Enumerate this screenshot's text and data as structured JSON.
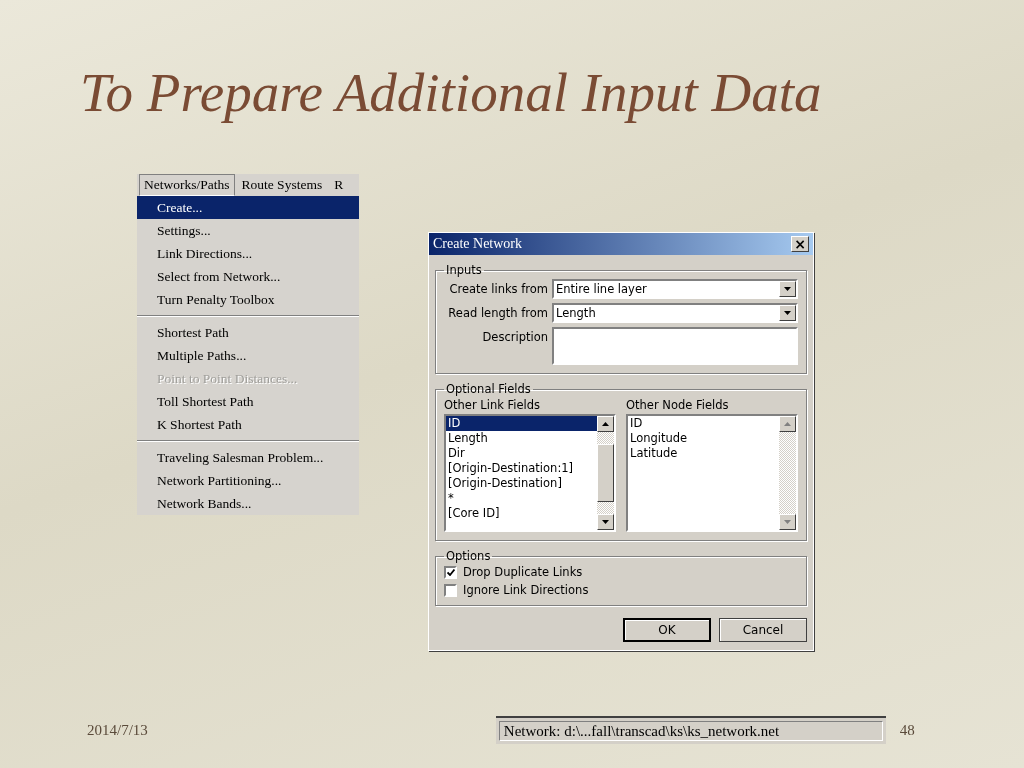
{
  "slide": {
    "title": "To Prepare Additional Input Data",
    "date": "2014/7/13",
    "page_number": "48"
  },
  "menu": {
    "menubar": [
      {
        "label": "Networks/Paths",
        "selected": true
      },
      {
        "label": "Route Systems",
        "selected": false
      },
      {
        "label": "R",
        "selected": false
      }
    ],
    "groups": [
      [
        {
          "label": "Create...",
          "selected": true,
          "disabled": false
        },
        {
          "label": "Settings...",
          "selected": false,
          "disabled": false
        },
        {
          "label": "Link Directions...",
          "selected": false,
          "disabled": false
        },
        {
          "label": "Select from Network...",
          "selected": false,
          "disabled": false
        },
        {
          "label": "Turn Penalty Toolbox",
          "selected": false,
          "disabled": false
        }
      ],
      [
        {
          "label": "Shortest Path",
          "selected": false,
          "disabled": false
        },
        {
          "label": "Multiple Paths...",
          "selected": false,
          "disabled": false
        },
        {
          "label": "Point to Point Distances...",
          "selected": false,
          "disabled": true
        },
        {
          "label": "Toll Shortest Path",
          "selected": false,
          "disabled": false
        },
        {
          "label": "K Shortest Path",
          "selected": false,
          "disabled": false
        }
      ],
      [
        {
          "label": "Traveling Salesman Problem...",
          "selected": false,
          "disabled": false
        },
        {
          "label": "Network Partitioning...",
          "selected": false,
          "disabled": false
        },
        {
          "label": "Network Bands...",
          "selected": false,
          "disabled": false
        }
      ]
    ]
  },
  "dialog": {
    "title": "Create Network",
    "close": "×",
    "inputs": {
      "legend": "Inputs",
      "create_links_from": {
        "label": "Create links from",
        "value": "Entire line layer"
      },
      "read_length_from": {
        "label": "Read length from",
        "value": "Length"
      },
      "description": {
        "label": "Description"
      }
    },
    "optional_fields": {
      "legend": "Optional Fields",
      "lists": [
        {
          "label": "Other Link Fields",
          "enabled": true,
          "items": [
            {
              "label": "ID",
              "selected": true
            },
            {
              "label": "Length",
              "selected": false
            },
            {
              "label": "Dir",
              "selected": false
            },
            {
              "label": "[Origin-Destination:1]",
              "selected": false
            },
            {
              "label": "[Origin-Destination]",
              "selected": false
            },
            {
              "label": "*",
              "selected": false
            },
            {
              "label": "[Core ID]",
              "selected": false
            }
          ]
        },
        {
          "label": "Other Node Fields",
          "enabled": false,
          "items": [
            {
              "label": "ID",
              "selected": false
            },
            {
              "label": "Longitude",
              "selected": false
            },
            {
              "label": "Latitude",
              "selected": false
            }
          ]
        }
      ]
    },
    "options": {
      "legend": "Options",
      "items": [
        {
          "label": "Drop Duplicate Links",
          "checked": true
        },
        {
          "label": "Ignore Link Directions",
          "checked": false
        }
      ]
    },
    "buttons": [
      {
        "label": "OK",
        "default": true
      },
      {
        "label": "Cancel",
        "default": false
      }
    ]
  },
  "status_bar": {
    "text": "Network: d:\\...fall\\transcad\\ks\\ks_network.net"
  }
}
